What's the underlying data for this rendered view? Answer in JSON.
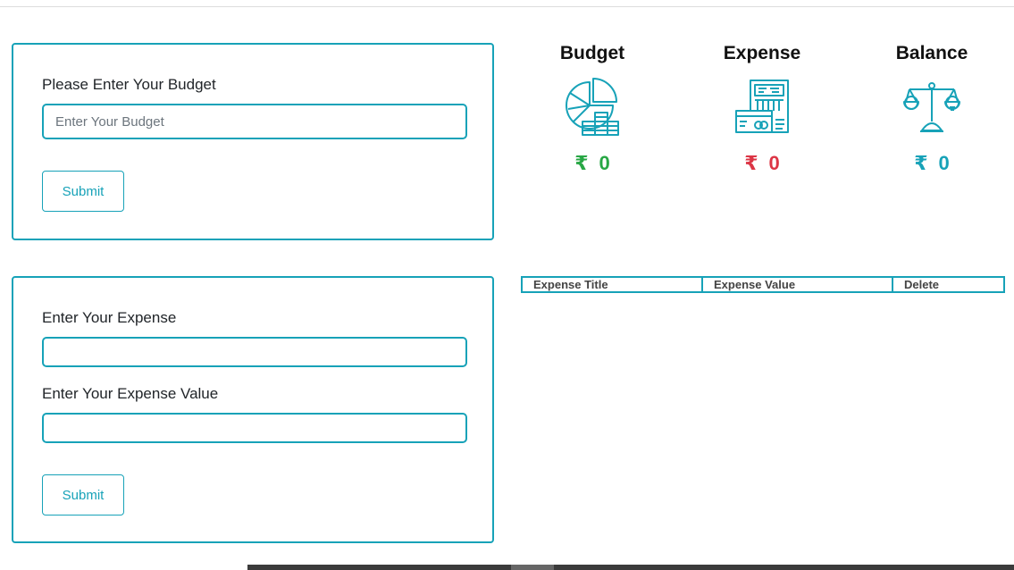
{
  "budget_form": {
    "label": "Please Enter Your Budget",
    "input_placeholder": "Enter Your Budget",
    "input_value": "",
    "submit_label": "Submit"
  },
  "expense_form": {
    "title_label": "Enter Your Expense",
    "title_value": "",
    "value_label": "Enter Your Expense Value",
    "value_value": "",
    "submit_label": "Submit"
  },
  "summary": {
    "currency": "₹",
    "budget": {
      "title": "Budget",
      "amount": "0",
      "color": "#28a745",
      "icon": "pie-chart-coins-icon"
    },
    "expense": {
      "title": "Expense",
      "amount": "0",
      "color": "#dc3545",
      "icon": "receipt-card-icon"
    },
    "balance": {
      "title": "Balance",
      "amount": "0",
      "color": "#17a2b8",
      "icon": "balance-scale-icon"
    }
  },
  "expense_table": {
    "columns": [
      "Expense Title",
      "Expense Value",
      "Delete"
    ],
    "rows": []
  },
  "colors": {
    "accent": "#17a2b8"
  }
}
